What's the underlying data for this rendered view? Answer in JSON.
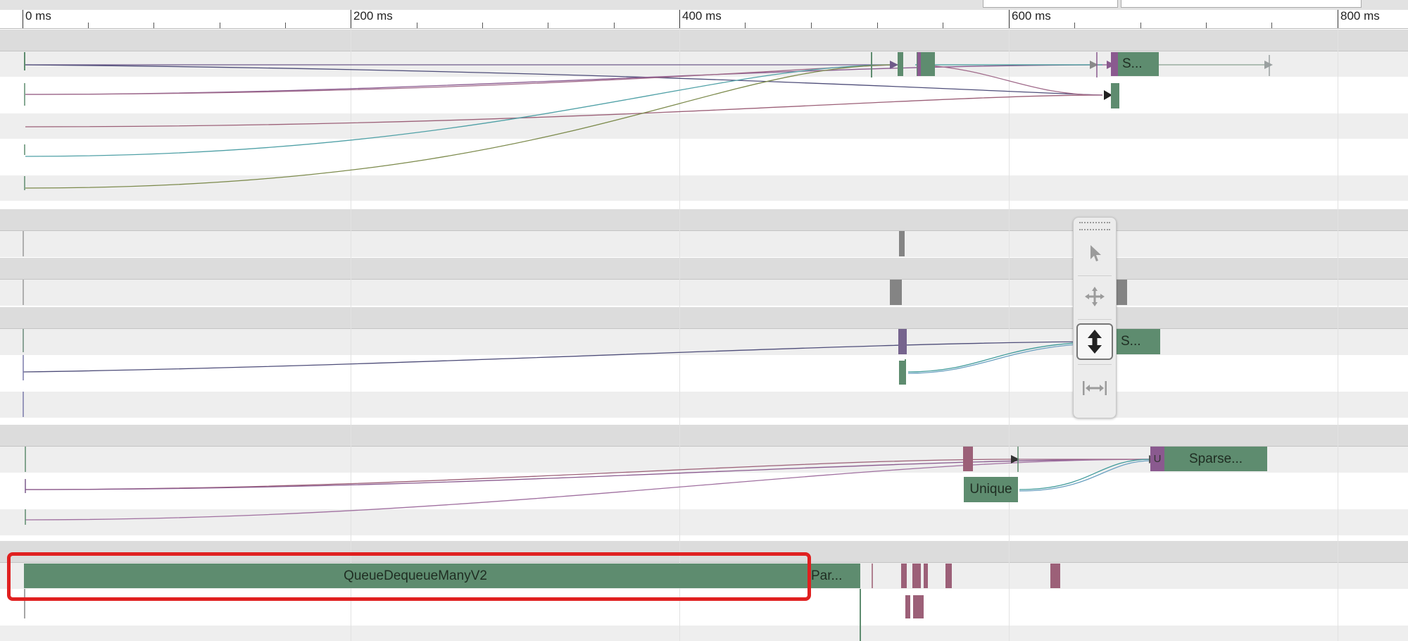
{
  "ruler": {
    "labels": [
      "0 ms",
      "200 ms",
      "400 ms",
      "600 ms",
      "800 ms"
    ]
  },
  "slices": {
    "s1": "S...",
    "s2": "S...",
    "sparse": "Sparse...",
    "unique": "Unique",
    "unique_small": "U",
    "queue": "QueueDequeueManyV2",
    "par": "Par..."
  },
  "toolbar": {
    "tools": [
      "selection-tool",
      "pan-tool",
      "zoom-tool",
      "timing-tool"
    ],
    "active": "zoom-tool"
  },
  "colors": {
    "slice_green": "#5e8c6f",
    "slice_purple": "#8a5a8f",
    "slice_mauve": "#9c6078",
    "highlight": "#e02020"
  }
}
